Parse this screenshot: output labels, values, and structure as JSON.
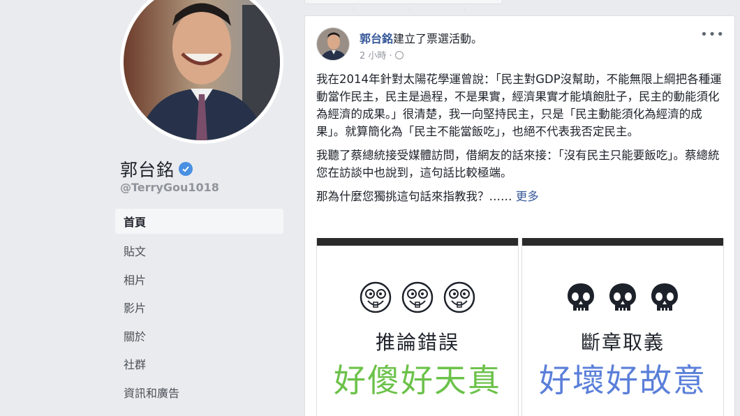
{
  "profile": {
    "name": "郭台銘",
    "handle": "@TerryGou1018",
    "verified_color": "#4a90e2"
  },
  "nav": {
    "items": [
      {
        "label": "首頁",
        "active": true
      },
      {
        "label": "貼文"
      },
      {
        "label": "相片"
      },
      {
        "label": "影片"
      },
      {
        "label": "關於"
      },
      {
        "label": "社群"
      },
      {
        "label": "資訊和廣告"
      }
    ]
  },
  "post": {
    "author": "郭台銘",
    "action": "建立了票選活動。",
    "time": "2 小時 · ",
    "more_menu": "•••",
    "paragraphs": [
      "我在2014年針對太陽花學運曾說：「民主對GDP沒幫助，不能無限上綱把各種運動當作民主，民主是過程，不是果實，經濟果實才能填飽肚子，民主的動能須化為經濟的成果。」很清楚，我一向堅持民主，只是「民主動能須化為經濟的成果」。就算簡化為「民主不能當飯吃」，也絕不代表我否定民主。",
      "我聽了蔡總統接受媒體訪問，借網友的話來接：「沒有民主只能要飯吃」。蔡總統您在訪談中也說到，這句話比較極端。"
    ],
    "teaser": "那為什麼您獨挑這句話來指教我？……",
    "see_more": "更多"
  },
  "poll": {
    "options": [
      {
        "title": "推論錯誤",
        "big_text": "好傻好天真",
        "icon": "crazy-face-icon",
        "color": "#6cc24a"
      },
      {
        "title": "斷章取義",
        "big_text": "好壞好故意",
        "icon": "skull-icon",
        "color": "#5b7fd9"
      }
    ]
  }
}
